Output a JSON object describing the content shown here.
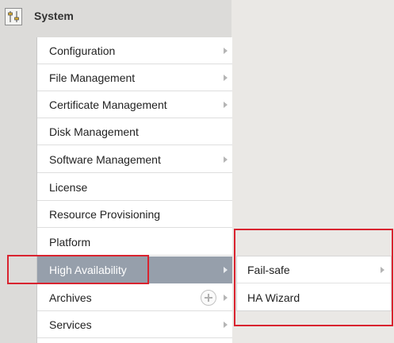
{
  "header": {
    "title": "System",
    "icon": "system-settings-icon"
  },
  "menu": {
    "items": [
      {
        "label": "Configuration",
        "has_submenu": true
      },
      {
        "label": "File Management",
        "has_submenu": true
      },
      {
        "label": "Certificate Management",
        "has_submenu": true
      },
      {
        "label": "Disk Management",
        "has_submenu": false
      },
      {
        "label": "Software Management",
        "has_submenu": true
      },
      {
        "label": "License",
        "has_submenu": false
      },
      {
        "label": "Resource Provisioning",
        "has_submenu": false
      },
      {
        "label": "Platform",
        "has_submenu": false
      },
      {
        "label": "High Availability",
        "has_submenu": true,
        "active": true
      },
      {
        "label": "Archives",
        "has_submenu": true,
        "has_add_icon": true
      },
      {
        "label": "Services",
        "has_submenu": true
      }
    ]
  },
  "submenu": {
    "items": [
      {
        "label": "Fail-safe",
        "has_submenu": true
      },
      {
        "label": "HA Wizard",
        "has_submenu": false
      }
    ]
  },
  "colors": {
    "active_item_bg": "#969fab",
    "highlight_border": "#d9232f",
    "panel_bg": "#dcdbd9",
    "page_bg": "#eae8e5"
  }
}
